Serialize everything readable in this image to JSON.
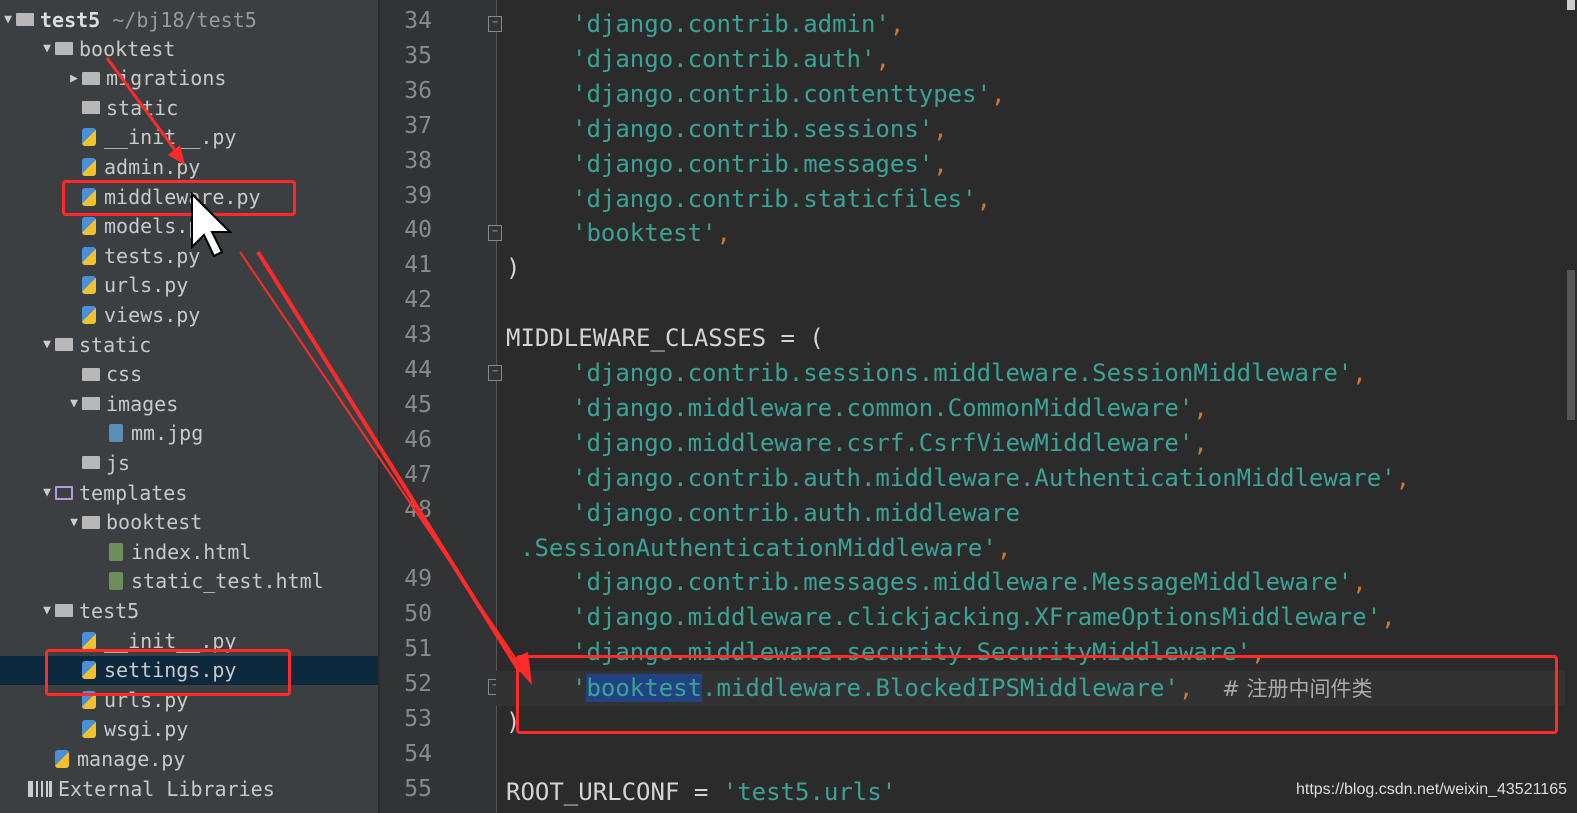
{
  "project": {
    "name": "test5",
    "path": "~/bj18/test5"
  },
  "tree": [
    {
      "label": "booktest",
      "type": "folder",
      "depth": 1,
      "expanded": true
    },
    {
      "label": "migrations",
      "type": "folder",
      "depth": 2,
      "expanded": false
    },
    {
      "label": "static",
      "type": "folder",
      "depth": 2
    },
    {
      "label": "__init__.py",
      "type": "py",
      "depth": 2
    },
    {
      "label": "admin.py",
      "type": "py",
      "depth": 2
    },
    {
      "label": "middleware.py",
      "type": "py",
      "depth": 2,
      "highlighted": true
    },
    {
      "label": "models.py",
      "type": "py",
      "depth": 2
    },
    {
      "label": "tests.py",
      "type": "py",
      "depth": 2
    },
    {
      "label": "urls.py",
      "type": "py",
      "depth": 2
    },
    {
      "label": "views.py",
      "type": "py",
      "depth": 2
    },
    {
      "label": "static",
      "type": "folder",
      "depth": 1,
      "expanded": true
    },
    {
      "label": "css",
      "type": "folder",
      "depth": 2
    },
    {
      "label": "images",
      "type": "folder",
      "depth": 2,
      "expanded": true
    },
    {
      "label": "mm.jpg",
      "type": "img",
      "depth": 3
    },
    {
      "label": "js",
      "type": "folder",
      "depth": 2
    },
    {
      "label": "templates",
      "type": "tpl",
      "depth": 1,
      "expanded": true
    },
    {
      "label": "booktest",
      "type": "folder",
      "depth": 2,
      "expanded": true
    },
    {
      "label": "index.html",
      "type": "html",
      "depth": 3
    },
    {
      "label": "static_test.html",
      "type": "html",
      "depth": 3
    },
    {
      "label": "test5",
      "type": "folder",
      "depth": 1,
      "expanded": true
    },
    {
      "label": "__init__.py",
      "type": "py",
      "depth": 2
    },
    {
      "label": "settings.py",
      "type": "py",
      "depth": 2,
      "selected": true,
      "highlighted": true
    },
    {
      "label": "urls.py",
      "type": "py",
      "depth": 2
    },
    {
      "label": "wsgi.py",
      "type": "py",
      "depth": 2
    },
    {
      "label": "manage.py",
      "type": "py",
      "depth": 1
    },
    {
      "label": "External Libraries",
      "type": "lib",
      "depth": 0
    }
  ],
  "editor": {
    "lines": [
      {
        "n": "34",
        "indent": 1,
        "str": "'django.contrib.admin'",
        "tail": ","
      },
      {
        "n": "35",
        "indent": 1,
        "str": "'django.contrib.auth'",
        "tail": ","
      },
      {
        "n": "36",
        "indent": 1,
        "str": "'django.contrib.contenttypes'",
        "tail": ","
      },
      {
        "n": "37",
        "indent": 1,
        "str": "'django.contrib.sessions'",
        "tail": ","
      },
      {
        "n": "38",
        "indent": 1,
        "str": "'django.contrib.messages'",
        "tail": ","
      },
      {
        "n": "39",
        "indent": 1,
        "str": "'django.contrib.staticfiles'",
        "tail": ","
      },
      {
        "n": "40",
        "indent": 1,
        "str": "'booktest'",
        "tail": ","
      },
      {
        "n": "41",
        "indent": 0,
        "plain": ")"
      },
      {
        "n": "42",
        "indent": 0,
        "plain": ""
      },
      {
        "n": "43",
        "indent": 0,
        "plain": "MIDDLEWARE_CLASSES = ("
      },
      {
        "n": "44",
        "indent": 1,
        "str": "'django.contrib.sessions.middleware.SessionMiddleware'",
        "tail": ","
      },
      {
        "n": "45",
        "indent": 1,
        "str": "'django.middleware.common.CommonMiddleware'",
        "tail": ","
      },
      {
        "n": "46",
        "indent": 1,
        "str": "'django.middleware.csrf.CsrfViewMiddleware'",
        "tail": ","
      },
      {
        "n": "47",
        "indent": 1,
        "str": "'django.contrib.auth.middleware.AuthenticationMiddleware'",
        "tail": ","
      },
      {
        "n": "48",
        "indent": 1,
        "str": "'django.contrib.auth.middleware",
        "tail": ""
      },
      {
        "n": "",
        "indent": -1,
        "str": ".SessionAuthenticationMiddleware'",
        "tail": ","
      },
      {
        "n": "49",
        "indent": 1,
        "str": "'django.contrib.messages.middleware.MessageMiddleware'",
        "tail": ","
      },
      {
        "n": "50",
        "indent": 1,
        "str": "'django.middleware.clickjacking.XFrameOptionsMiddleware'",
        "tail": ","
      },
      {
        "n": "51",
        "indent": 1,
        "str": "'django.middleware.security.SecurityMiddleware'",
        "tail": ","
      },
      {
        "n": "52",
        "indent": 1,
        "special": true,
        "sel": "booktest",
        "rest": ".middleware.BlockedIPSMiddleware'",
        "tail": ",",
        "comment": "# 注册中间件类"
      },
      {
        "n": "53",
        "indent": 0,
        "plain": ")"
      },
      {
        "n": "54",
        "indent": 0,
        "plain": ""
      },
      {
        "n": "55",
        "indent": 0,
        "plain": "ROOT_URLCONF = ",
        "str2": "'test5.urls'"
      }
    ]
  },
  "watermark": "https://blog.csdn.net/weixin_43521165",
  "colors": {
    "sidebar": "#3c3f41",
    "editor": "#2b2b2b",
    "string": "#3aa396",
    "annotation": "#ff2a2a",
    "selection": "#214283"
  }
}
